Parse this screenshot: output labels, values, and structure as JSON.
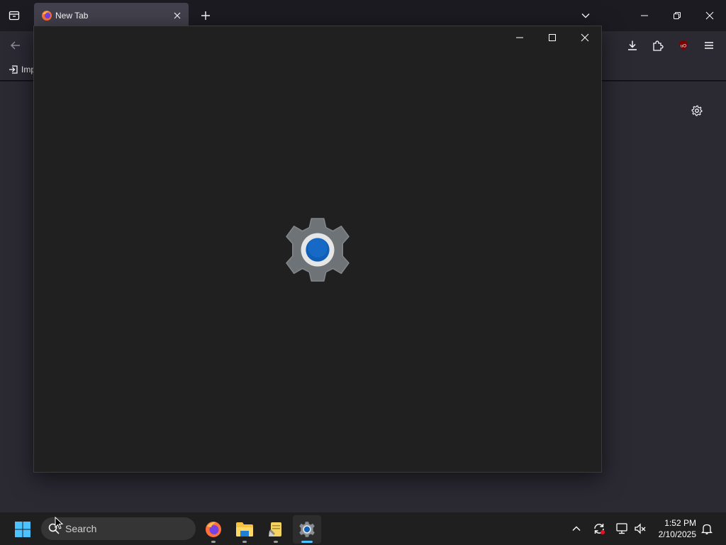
{
  "browser": {
    "tab": {
      "title": "New Tab"
    },
    "bookmarks": {
      "import_label": "Imp"
    }
  },
  "settings_window": {
    "logo_icon": "settings-gear-icon"
  },
  "taskbar": {
    "search_label": "Search",
    "apps": [
      "firefox-icon",
      "file-explorer-icon",
      "notepad-icon",
      "settings-icon"
    ],
    "clock": {
      "time": "1:52 PM",
      "date": "2/10/2025"
    }
  },
  "colors": {
    "accent": "#4cc2ff",
    "gear_gray": "#6e7377",
    "gear_blue": "#0f5fb6"
  }
}
